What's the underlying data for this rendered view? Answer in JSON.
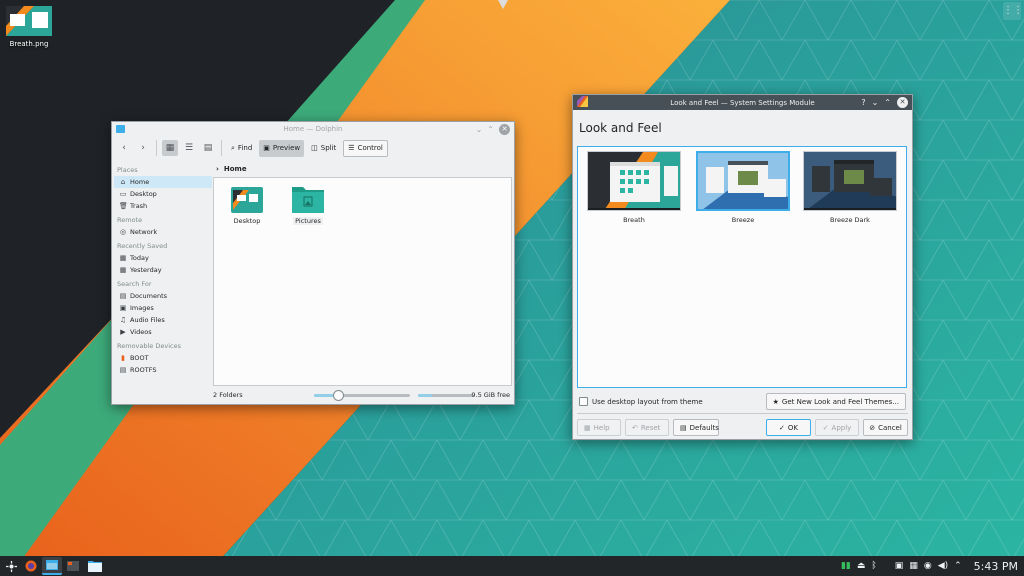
{
  "colors": {
    "accent": "#3daee9",
    "orange": "#f28a1e",
    "teal": "#2ba698",
    "dark": "#1f2327",
    "panel": "#232629",
    "window_bg": "#eff0f1",
    "titlebar_active": "#475057"
  },
  "desktop": {
    "file_icon_label": "Breath.png"
  },
  "dolphin": {
    "window_title": "Home — Dolphin",
    "toolbar": {
      "back_icon": "back-arrow-icon",
      "forward_icon": "forward-arrow-icon",
      "find_label": "Find",
      "preview_label": "Preview",
      "split_label": "Split",
      "control_label": "Control"
    },
    "sidebar": {
      "places_header": "Places",
      "places": [
        "Home",
        "Desktop",
        "Trash"
      ],
      "remote_header": "Remote",
      "remote": [
        "Network"
      ],
      "recent_header": "Recently Saved",
      "recent": [
        "Today",
        "Yesterday"
      ],
      "search_header": "Search For",
      "search": [
        "Documents",
        "Images",
        "Audio Files",
        "Videos"
      ],
      "removable_header": "Removable Devices",
      "removable": [
        "BOOT",
        "ROOTFS"
      ]
    },
    "breadcrumb": "Home",
    "folders": [
      "Desktop",
      "Pictures"
    ],
    "status": {
      "count": "2 Folders",
      "free": "9.5 GiB free",
      "zoom_fraction": 0.25,
      "used_fraction": 0.25
    }
  },
  "settings": {
    "window_title": "Look and Feel — System Settings Module",
    "heading": "Look and Feel",
    "themes": [
      {
        "name": "Breath",
        "selected": false
      },
      {
        "name": "Breeze",
        "selected": true
      },
      {
        "name": "Breeze Dark",
        "selected": false
      }
    ],
    "use_layout_label": "Use desktop layout from theme",
    "use_layout_checked": false,
    "get_new_label": "Get New Look and Feel Themes...",
    "buttons": {
      "help": "Help",
      "reset": "Reset",
      "defaults": "Defaults",
      "ok": "OK",
      "apply": "Apply",
      "cancel": "Cancel"
    }
  },
  "panel": {
    "clock": "5:43 PM"
  }
}
